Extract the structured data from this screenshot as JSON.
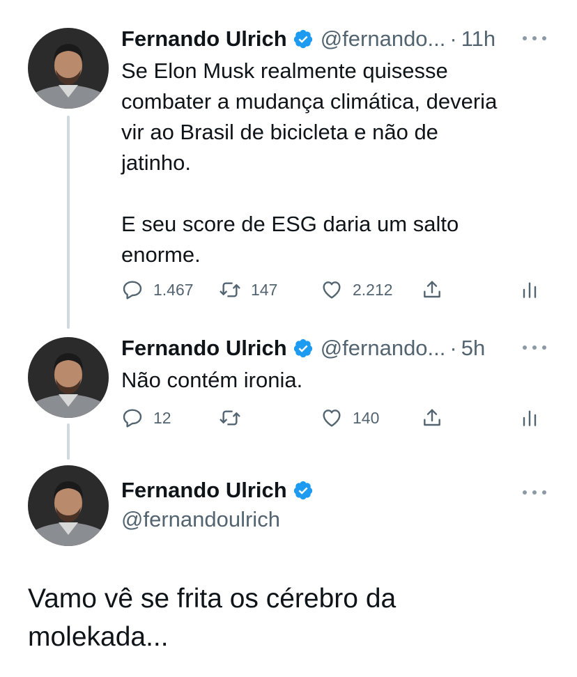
{
  "tweets": [
    {
      "name": "Fernando Ulrich",
      "handle": "@fernando...",
      "separator": "·",
      "time": "11h",
      "text": "Se Elon Musk realmente quisesse\ncombater a mudança climática, deveria\nvir ao Brasil de bicicleta e não de\njatinho.\n\nE seu score de ESG daria um salto\nenorme.",
      "replies": "1.467",
      "retweets": "147",
      "likes": "2.212"
    },
    {
      "name": "Fernando Ulrich",
      "handle": "@fernando...",
      "separator": "·",
      "time": "5h",
      "text": "Não contém ironia.",
      "replies": "12",
      "retweets": "",
      "likes": "140"
    },
    {
      "name": "Fernando Ulrich",
      "handle": "@fernandoulrich"
    }
  ],
  "caption": "Vamo vê se frita os cérebro da\nmolekada...",
  "colors": {
    "verified": "#1d9bf0",
    "secondary_text": "#536471",
    "thread_line": "#cfd9de"
  }
}
